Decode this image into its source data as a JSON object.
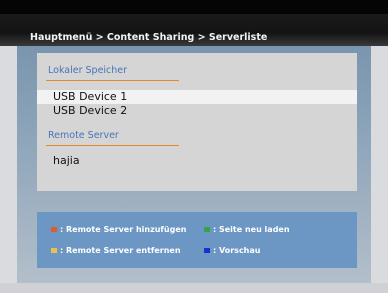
{
  "breadcrumb": "Hauptmenü > Content Sharing > Serverliste",
  "local": {
    "title": "Lokaler Speicher",
    "items": [
      "USB Device 1",
      "USB Device 2"
    ],
    "selected_index": 0
  },
  "remote": {
    "title": "Remote Server",
    "items": [
      "hajia"
    ]
  },
  "legend": {
    "red": {
      "label": ": Remote Server hinzufügen",
      "color": "#e05a2a",
      "icon": "red-key-icon"
    },
    "green": {
      "label": ": Seite neu laden",
      "color": "#3aa04a",
      "icon": "green-key-icon"
    },
    "yellow": {
      "label": ": Remote Server entfernen",
      "color": "#e8c24a",
      "icon": "yellow-key-icon"
    },
    "blue": {
      "label": ": Vorschau",
      "color": "#1a2fd0",
      "icon": "blue-key-icon"
    }
  },
  "colors": {
    "accent_title": "#4a73b8",
    "underline": "#e08c2c",
    "legend_bg": "#6c97c4"
  }
}
